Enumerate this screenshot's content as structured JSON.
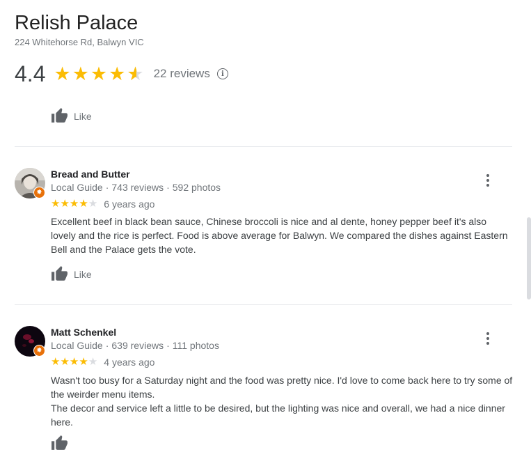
{
  "place": {
    "name": "Relish Palace",
    "address": "224 Whitehorse Rd, Balwyn VIC",
    "rating": "4.4",
    "rating_value": 4.4,
    "review_count": "22 reviews",
    "info_icon": "info-icon"
  },
  "like_label": "Like",
  "colors": {
    "star": "#fbbc04",
    "star_empty": "#dadce0",
    "badge": "#e8710a",
    "muted": "#70757a"
  },
  "reviews": [
    {
      "name": "Bread and Butter",
      "guide": "Local Guide",
      "reviews_count": "743 reviews",
      "photos_count": "592 photos",
      "stars": 4,
      "age": "6 years ago",
      "text": [
        "Excellent beef in black bean sauce, Chinese broccoli is nice and al dente, honey pepper beef it's also lovely and the rice is perfect. Food is above average for Balwyn. We compared the dishes against Eastern Bell and the Palace gets the vote."
      ]
    },
    {
      "name": "Matt Schenkel",
      "guide": "Local Guide",
      "reviews_count": "639 reviews",
      "photos_count": "111 photos",
      "stars": 4,
      "age": "4 years ago",
      "text": [
        "Wasn't too busy for a Saturday night and the food was pretty nice. I'd love to come back here to try some of the weirder menu items.",
        "The decor and service left a little to be desired, but the lighting was nice and overall, we had a nice dinner here."
      ]
    }
  ]
}
